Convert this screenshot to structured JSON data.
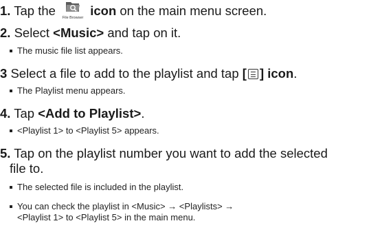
{
  "steps": [
    {
      "num": "1.",
      "pre": "Tap the",
      "icon_caption": "File Browser",
      "icon": "file-browser-icon",
      "post": "icon",
      "tail": "on the main menu screen.",
      "subs": []
    },
    {
      "num": "2.",
      "pre": "Select",
      "bold": "<Music>",
      "post": "and tap on it.",
      "subs": [
        "The music file list appears."
      ]
    },
    {
      "num": "3",
      "pre": "Select a file to add to the playlist and tap",
      "bracket_open": "[",
      "icon": "menu-icon",
      "bracket_close": "] icon",
      "post": ".",
      "subs": [
        "The Playlist menu appears."
      ]
    },
    {
      "num": "4.",
      "pre": "Tap",
      "bold": "<Add to Playlist>",
      "post": ".",
      "subs": [
        "<Playlist 1> to <Playlist 5> appears."
      ]
    },
    {
      "num": "5.",
      "line1": "Tap on the playlist number you want to add the selected",
      "line2": "file to.",
      "subs": [
        "The selected file is included in the playlist.",
        "You can check the playlist in <Music> → <Playlists> →",
        "<Playlist 1> to <Playlist 5> in the main menu."
      ]
    }
  ]
}
